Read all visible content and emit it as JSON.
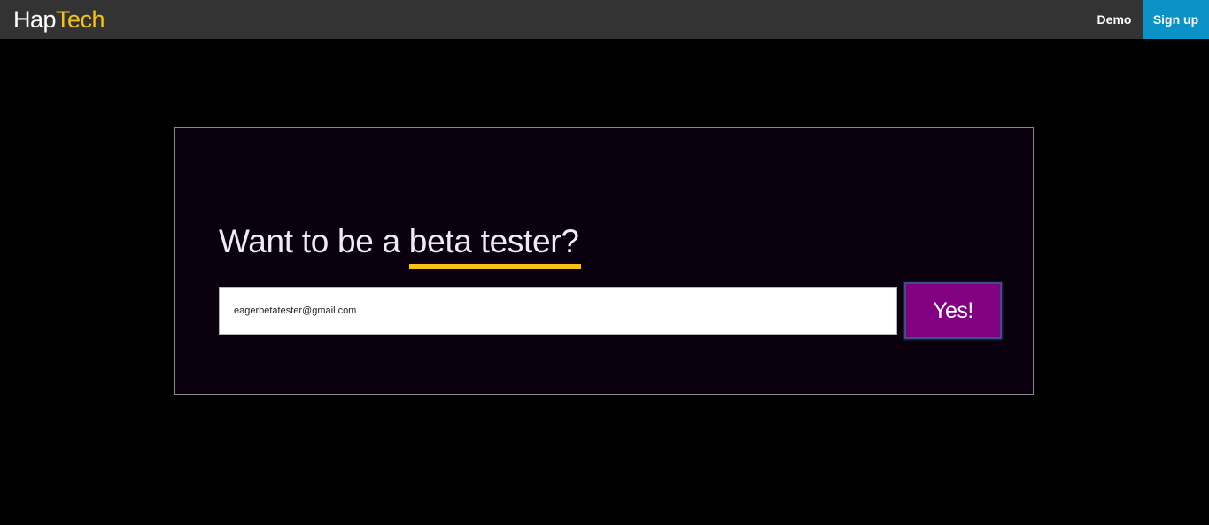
{
  "colors": {
    "nav_background": "#333333",
    "logo_accent": "#f5c216",
    "signup_background": "#0b93c8",
    "panel_background": "#0b000d",
    "button_background": "#820082",
    "underline": "#f5c216"
  },
  "navbar": {
    "logo_part1": "Hap",
    "logo_part2": "Tech",
    "demo_label": "Demo",
    "signup_label": "Sign up"
  },
  "hero": {
    "headline_prefix": "Want to be a ",
    "headline_highlight": "beta tester?",
    "email_value": "eagerbetatester@gmail.com",
    "submit_label": "Yes!"
  }
}
